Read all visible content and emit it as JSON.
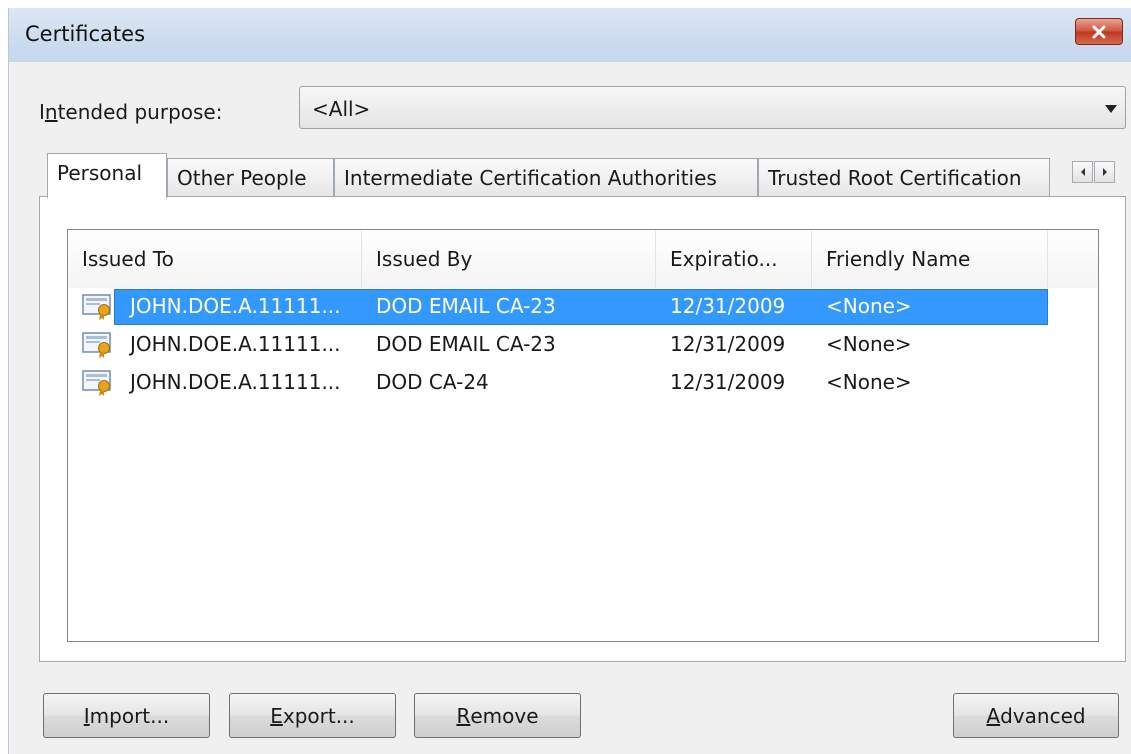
{
  "window": {
    "title": "Certificates"
  },
  "purpose": {
    "label_pre": "I",
    "label_ul": "n",
    "label_post": "tended purpose:",
    "value": "<All>"
  },
  "tabs": [
    {
      "label": "Personal"
    },
    {
      "label": "Other People"
    },
    {
      "label": "Intermediate Certification Authorities"
    },
    {
      "label": "Trusted Root Certification"
    }
  ],
  "list": {
    "columns": [
      "Issued To",
      "Issued By",
      "Expiratio...",
      "Friendly Name"
    ],
    "rows": [
      {
        "issued_to": "JOHN.DOE.A.11111...",
        "issued_by": "DOD EMAIL CA-23",
        "expiration": "12/31/2009",
        "friendly_name": "<None>",
        "selected": true
      },
      {
        "issued_to": "JOHN.DOE.A.11111...",
        "issued_by": "DOD EMAIL CA-23",
        "expiration": "12/31/2009",
        "friendly_name": "<None>",
        "selected": false
      },
      {
        "issued_to": "JOHN.DOE.A.11111...",
        "issued_by": "DOD CA-24",
        "expiration": "12/31/2009",
        "friendly_name": "<None>",
        "selected": false
      }
    ]
  },
  "buttons": {
    "import": {
      "ul": "I",
      "rest": "mport..."
    },
    "export": {
      "ul": "E",
      "rest": "xport..."
    },
    "remove": {
      "ul": "R",
      "rest": "emove"
    },
    "advanced": {
      "ul": "A",
      "rest": "dvanced"
    }
  },
  "colors": {
    "selection": "#3399ff",
    "close": "#c0381f"
  },
  "icons": {
    "close": "close-icon",
    "cert": "certificate-icon",
    "dropdown": "chevron-down-icon"
  }
}
